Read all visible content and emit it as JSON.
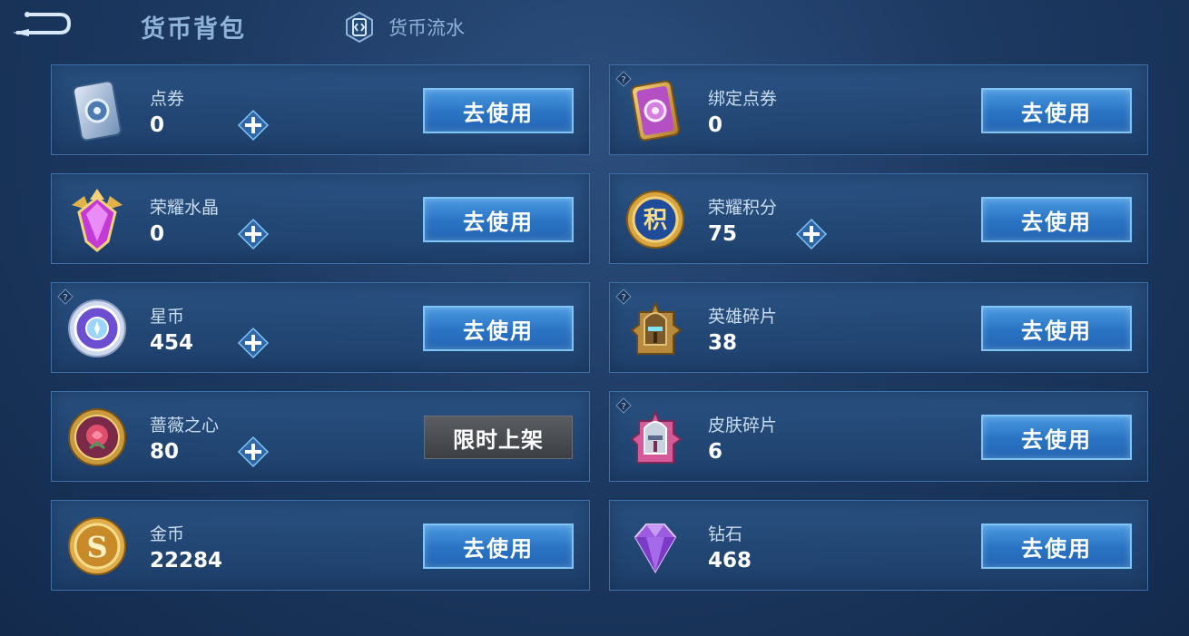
{
  "header": {
    "title": "货币背包",
    "flow_label": "货币流水"
  },
  "currencies": [
    {
      "name": "点券",
      "amount": "0",
      "button": "去使用",
      "icon": "coupon-icon"
    },
    {
      "name": "绑定点券",
      "amount": "0",
      "button": "去使用",
      "icon": "bound-coupon-icon"
    },
    {
      "name": "荣耀水晶",
      "amount": "0",
      "button": "去使用",
      "icon": "glory-crystal-icon"
    },
    {
      "name": "荣耀积分",
      "amount": "75",
      "button": "去使用",
      "icon": "glory-points-icon",
      "icon_text": "积"
    },
    {
      "name": "星币",
      "amount": "454",
      "button": "去使用",
      "icon": "star-coin-icon"
    },
    {
      "name": "英雄碎片",
      "amount": "38",
      "button": "去使用",
      "icon": "hero-fragment-icon"
    },
    {
      "name": "蔷薇之心",
      "amount": "80",
      "button": "限时上架",
      "icon": "rose-heart-icon"
    },
    {
      "name": "皮肤碎片",
      "amount": "6",
      "button": "去使用",
      "icon": "skin-fragment-icon"
    },
    {
      "name": "金币",
      "amount": "22284",
      "button": "去使用",
      "icon": "gold-coin-icon"
    },
    {
      "name": "钻石",
      "amount": "468",
      "button": "去使用",
      "icon": "diamond-icon"
    }
  ],
  "colors": {
    "accent_button": "#2a73c4",
    "button_border": "#7ec4f7",
    "card_border": "#3e6fa6",
    "title_text": "#8fb2d8"
  }
}
